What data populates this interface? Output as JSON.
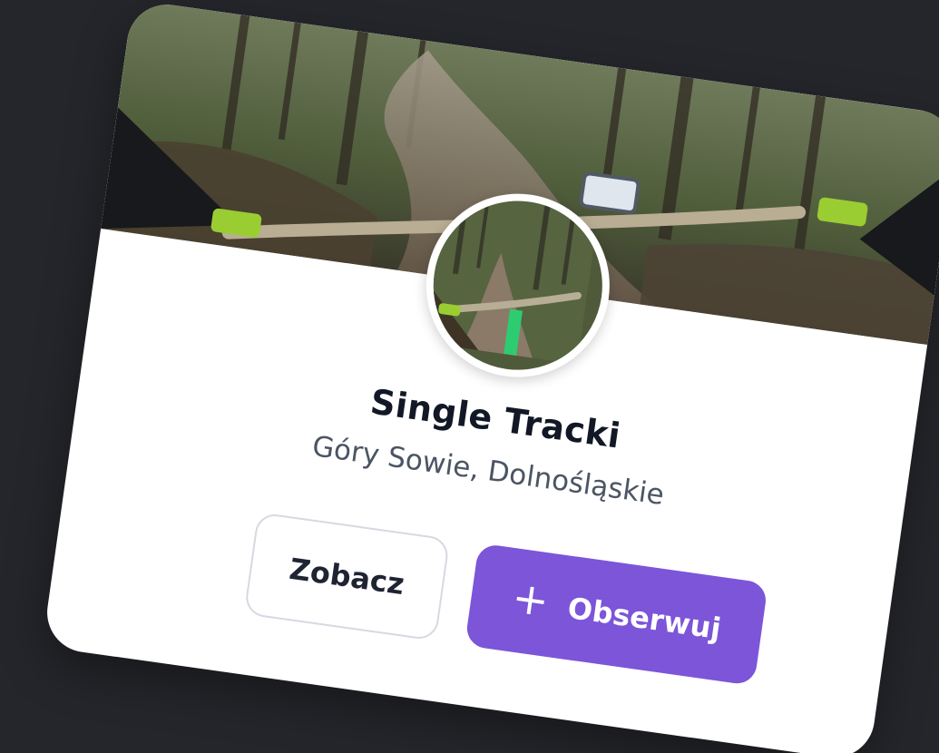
{
  "card": {
    "title": "Single Tracki",
    "subtitle": "Góry Sowie, Dolnośląskie"
  },
  "actions": {
    "view_label": "Zobacz",
    "follow_label": "Obserwuj",
    "follow_icon": "plus-icon"
  },
  "colors": {
    "background": "#25262b",
    "accent": "#7c55d9",
    "title": "#121826",
    "subtitle": "#4b5563"
  }
}
